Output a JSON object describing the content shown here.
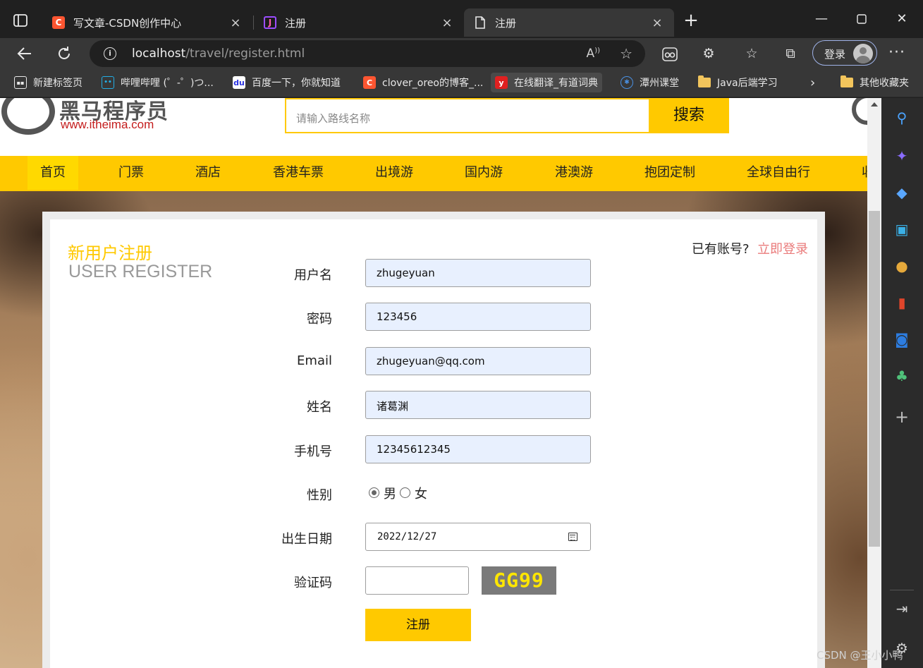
{
  "browser": {
    "tabs": [
      {
        "title": "写文章-CSDN创作中心",
        "favicon": "csdn-icon",
        "favicon_color": "#fc5531"
      },
      {
        "title": "注册",
        "favicon": "jetbrains-icon",
        "favicon_color": "#9b4dff"
      },
      {
        "title": "注册",
        "favicon": "document-icon",
        "favicon_color": "#e8e8e8"
      }
    ],
    "url_host": "localhost",
    "url_path": "/travel/register.html",
    "profile_button": "登录",
    "bookmarks": [
      {
        "label": "新建标签页",
        "icon": "newtab-icon"
      },
      {
        "label": "哔哩哔哩 (゜-゜)つ...",
        "icon": "bilibili-icon"
      },
      {
        "label": "百度一下，你就知道",
        "icon": "baidu-icon"
      },
      {
        "label": "clover_oreo的博客_...",
        "icon": "csdn-icon"
      },
      {
        "label": "在线翻译_有道词典",
        "icon": "youdao-icon"
      },
      {
        "label": "潭州课堂",
        "icon": "tanzhou-icon"
      },
      {
        "label": "Java后端学习",
        "icon": "folder-icon"
      },
      {
        "label": "其他收藏夹",
        "icon": "folder-icon"
      }
    ]
  },
  "site": {
    "logo_cn": "黑马程序员",
    "logo_en": "www.itheima.com",
    "search_placeholder": "请输入路线名称",
    "search_button": "搜索",
    "nav": [
      "首页",
      "门票",
      "酒店",
      "香港车票",
      "出境游",
      "国内游",
      "港澳游",
      "抱团定制",
      "全球自由行",
      "收"
    ]
  },
  "register": {
    "title_cn": "新用户注册",
    "title_en": "USER REGISTER",
    "have_account": "已有账号?",
    "login_link": "立即登录",
    "fields": [
      {
        "label": "用户名",
        "value": "zhugeyuan"
      },
      {
        "label": "密码",
        "value": "123456"
      },
      {
        "label": "Email",
        "value": "zhugeyuan@qq.com"
      },
      {
        "label": "姓名",
        "value": "诸葛渊"
      },
      {
        "label": "手机号",
        "value": "12345612345"
      }
    ],
    "gender_label": "性别",
    "gender_options": [
      "男",
      "女"
    ],
    "gender_selected": "男",
    "birthday_label": "出生日期",
    "birthday_value": "2022/12/27",
    "captcha_label": "验证码",
    "captcha_text": "GG99",
    "submit": "注册"
  },
  "watermark": "CSDN @王小小鸭",
  "colors": {
    "brand_yellow": "#ffc900",
    "login_link": "#ea7b7b",
    "logo_red": "#c41d1d"
  }
}
